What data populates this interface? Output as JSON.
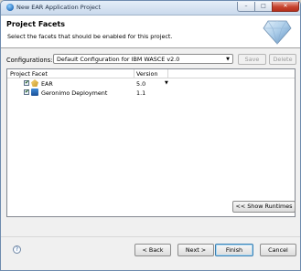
{
  "window": {
    "title": "New EAR Application Project",
    "controls": {
      "minimize": "–",
      "maximize": "□",
      "close": "✕"
    }
  },
  "header": {
    "title": "Project Facets",
    "description": "Select the facets that should be enabled for this project."
  },
  "configuration": {
    "label": "Configurations:",
    "selected": "Default Configuration for IBM WASCE v2.0",
    "save_label": "Save",
    "delete_label": "Delete"
  },
  "table": {
    "columns": [
      "Project Facet",
      "Version"
    ],
    "rows": [
      {
        "facet": "EAR",
        "version": "5.0",
        "checked": true,
        "icon": "ear-icon"
      },
      {
        "facet": "Geronimo Deployment",
        "version": "1.1",
        "checked": true,
        "icon": "geronimo-icon"
      }
    ]
  },
  "show_runtimes_label": "<< Show Runtimes",
  "footer": {
    "help": "?",
    "back_label": "< Back",
    "next_label": "Next >",
    "finish_label": "Finish",
    "cancel_label": "Cancel"
  },
  "colors": {
    "accent": "#3c7fb1",
    "header_bg": "#ffffff",
    "dialog_bg": "#f0f0f0"
  }
}
